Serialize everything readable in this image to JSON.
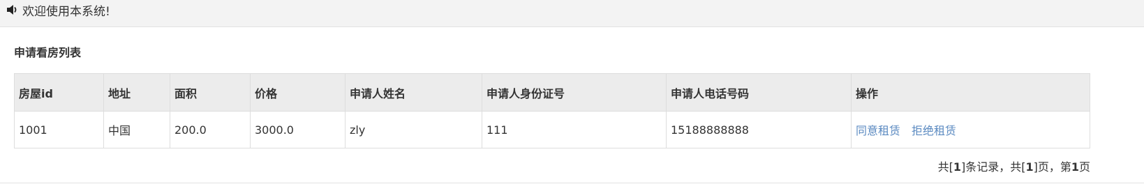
{
  "topbar": {
    "icon": "speaker-icon",
    "welcome_text": "欢迎使用本系统!"
  },
  "panel": {
    "title": "申请看房列表"
  },
  "table": {
    "headers": [
      "房屋id",
      "地址",
      "面积",
      "价格",
      "申请人姓名",
      "申请人身份证号",
      "申请人电话号码",
      "操作"
    ],
    "rows": [
      {
        "house_id": "1001",
        "address": "中国",
        "area": "200.0",
        "price": "3000.0",
        "applicant_name": "zly",
        "applicant_id_number": "111",
        "applicant_phone": "15188888888",
        "actions": [
          "同意租赁",
          "拒绝租赁"
        ]
      }
    ]
  },
  "pager": {
    "prefix_total": "共[",
    "total_records": "1",
    "records_suffix": "]条记录，共[",
    "total_pages": "1",
    "pages_suffix": "]页，第",
    "current_page": "1",
    "page_suffix": "页"
  },
  "colors": {
    "header_bg": "#ececec",
    "topbar_bg": "#f3f3f3",
    "link": "#5b8ac1",
    "border": "#dddddd"
  }
}
